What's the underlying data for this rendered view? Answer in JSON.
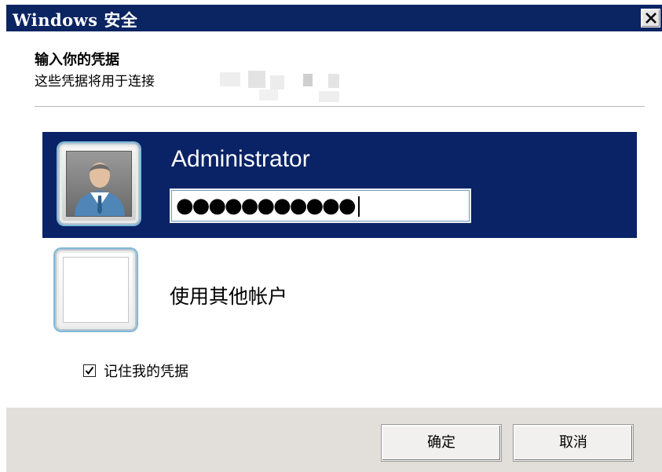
{
  "window": {
    "title": "Windows 安全"
  },
  "heading": "输入你的凭据",
  "subheading": "这些凭据将用于连接",
  "credential": {
    "username": "Administrator",
    "password_mask": "●●●●●●●●●●●",
    "password_length": 11
  },
  "other_account": {
    "label": "使用其他帐户"
  },
  "remember": {
    "label": "记住我的凭据",
    "checked": true
  },
  "buttons": {
    "ok": "确定",
    "cancel": "取消"
  },
  "colors": {
    "titlebar": "#0b2462",
    "selected_tile": "#0a2366",
    "footer": "#e2dfdb"
  },
  "icons": {
    "user_avatar": "user-avatar-icon",
    "close": "close-icon",
    "check": "checkmark-icon"
  }
}
